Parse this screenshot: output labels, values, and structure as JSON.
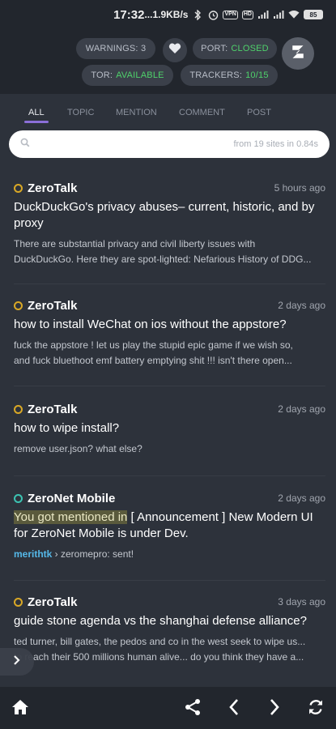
{
  "status_bar": {
    "time": "17:32",
    "net_speed": "...1.9KB/s",
    "battery": "85"
  },
  "header": {
    "warnings": {
      "label": "WARNINGS:",
      "value": "3"
    },
    "port": {
      "label": "PORT:",
      "value": "CLOSED"
    },
    "tor": {
      "label": "TOR:",
      "value": "AVAILABLE"
    },
    "trackers": {
      "label": "TRACKERS:",
      "value": "10/15"
    }
  },
  "tabs": [
    {
      "label": "ALL",
      "active": true
    },
    {
      "label": "TOPIC",
      "active": false
    },
    {
      "label": "MENTION",
      "active": false
    },
    {
      "label": "COMMENT",
      "active": false
    },
    {
      "label": "POST",
      "active": false
    }
  ],
  "search": {
    "value": "",
    "meta": "from 19 sites in 0.84s"
  },
  "feed": [
    {
      "site": "ZeroTalk",
      "time": "5 hours ago",
      "title": "DuckDuckGo's privacy abuses– current, historic, and by proxy",
      "body_line1": "There are substantial privacy and civil liberty issues with",
      "body_line2": "DuckDuckGo. Here they are spot-lighted: Nefarious History of DDG..."
    },
    {
      "site": "ZeroTalk",
      "time": "2 days ago",
      "title": "how to install WeChat on ios without the appstore?",
      "body_line1": "fuck the appstore ! let us play the stupid epic game if we wish so,",
      "body_line2": "and fuck bluethoot emf battery emptying shit !!! isn't there open..."
    },
    {
      "site": "ZeroTalk",
      "time": "2 days ago",
      "title": "how to wipe install?",
      "body_line1": "remove user.json? what else?"
    },
    {
      "site": "ZeroNet Mobile",
      "time": "2 days ago",
      "title_highlight": "You got mentioned in",
      "title_rest": " [ Announcement ] New Modern UI for ZeroNet Mobile is under Dev.",
      "mention_user": "merithtk",
      "mention_rest": " › zeromepro: sent!"
    },
    {
      "site": "ZeroTalk",
      "time": "3 days ago",
      "title": "guide stone agenda vs the shanghai defense alliance?",
      "body_line1": "ted turner, bill gates, the pedos and co in the west seek to wipe us...",
      "body_line2": "to reach their 500 millions human alive... do you think they have a..."
    }
  ],
  "colors": {
    "background": "#2d323b",
    "bar": "#22262d",
    "accent_tab": "#8b6fd8",
    "status_ok": "#4fd16b",
    "zerotalk_ring": "#d9a826",
    "zeronet_ring": "#3cc3b2",
    "mention_link": "#55b8e8"
  },
  "icons": {
    "heart": "heart-icon",
    "logo": "zeronet-logo-icon",
    "search": "search-icon",
    "home": "home-icon",
    "share": "share-icon",
    "back": "chevron-left-icon",
    "forward": "chevron-right-icon",
    "reload": "reload-icon",
    "side_toggle": "chevron-right-icon"
  }
}
